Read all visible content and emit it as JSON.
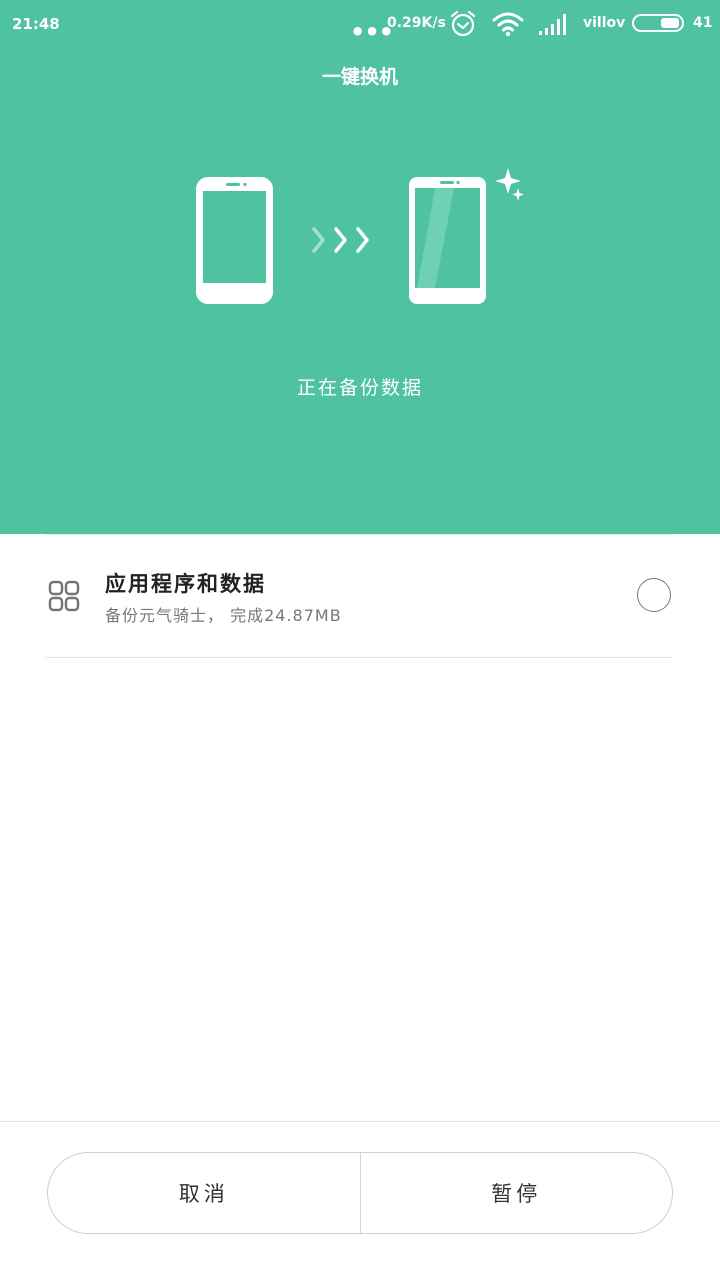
{
  "status_bar": {
    "time": "21:48",
    "dots": "•••",
    "net_speed": "0.29K/s",
    "carrier": "villov",
    "battery_level": "41",
    "battery_fraction": 0.41,
    "icons": [
      "alarm-clock-icon",
      "wifi-icon",
      "signal-bars-icon",
      "battery-icon"
    ]
  },
  "header": {
    "title": "一键换机"
  },
  "hero": {
    "status_text": "正在备份数据",
    "illustration_icons": [
      "old-phone-icon",
      "transfer-arrows-icon",
      "new-phone-icon",
      "sparkle-icon"
    ]
  },
  "task": {
    "icon": "apps-grid-icon",
    "title": "应用程序和数据",
    "subtitle": "备份元气骑士， 完成24.87MB"
  },
  "footer": {
    "cancel_label": "取消",
    "pause_label": "暂停"
  },
  "colors": {
    "accent": "#4fc2a1",
    "background": "#ffffff"
  }
}
